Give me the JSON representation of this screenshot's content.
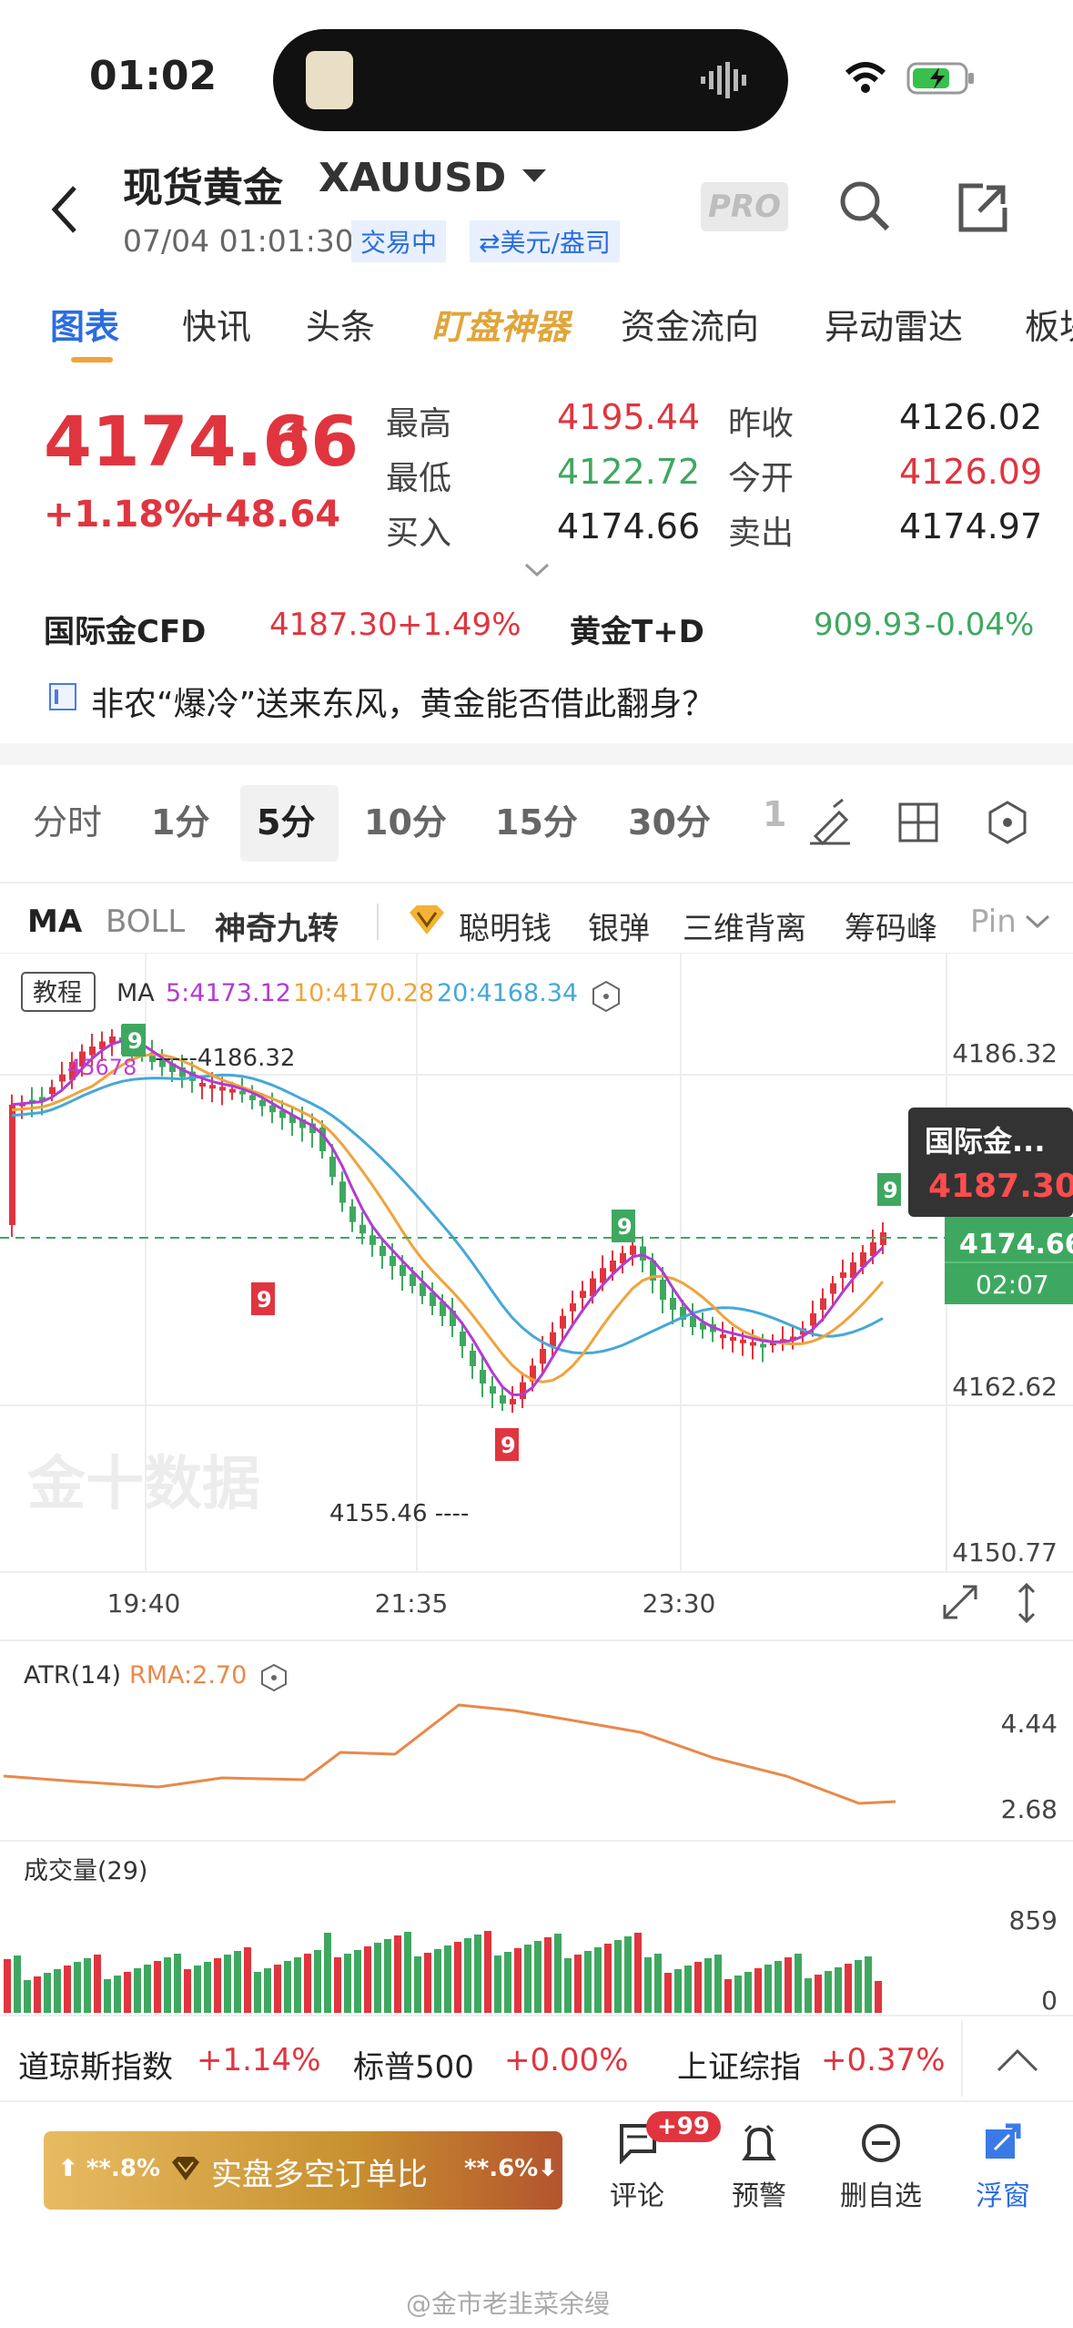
{
  "status_bar": {
    "time": "01:02"
  },
  "header": {
    "title": "现货黄金",
    "symbol": "XAUUSD",
    "datetime": "07/04 01:01:30",
    "trading_status": "交易中",
    "unit": "⇄美元/盎司",
    "pro_badge": "PRO"
  },
  "tabs": [
    {
      "label": "图表"
    },
    {
      "label": "快讯"
    },
    {
      "label": "头条"
    },
    {
      "label": "盯盘神器"
    },
    {
      "label": "资金流向"
    },
    {
      "label": "异动雷达"
    },
    {
      "label": "板块"
    }
  ],
  "quote": {
    "price": "4174.66",
    "arrow": "⬆",
    "change_pct": "+1.18%",
    "change": "+48.64",
    "stats": [
      {
        "label": "最高",
        "value": "4195.44",
        "color": "red"
      },
      {
        "label": "昨收",
        "value": "4126.02",
        "color": "dark"
      },
      {
        "label": "最低",
        "value": "4122.72",
        "color": "green"
      },
      {
        "label": "今开",
        "value": "4126.09",
        "color": "red"
      },
      {
        "label": "买入",
        "value": "4174.66",
        "color": "dark"
      },
      {
        "label": "卖出",
        "value": "4174.97",
        "color": "dark"
      }
    ]
  },
  "related": [
    {
      "name": "国际金CFD",
      "price": "4187.30",
      "change": "+1.49%",
      "dir": "up"
    },
    {
      "name": "黄金T+D",
      "price": "909.93",
      "change": "-0.04%",
      "dir": "down"
    }
  ],
  "news": {
    "headline": "非农“爆冷”送来东风，黄金能否借此翻身？"
  },
  "periods": [
    "分时",
    "1分",
    "5分",
    "10分",
    "15分",
    "30分",
    "1"
  ],
  "selected_period": "5分",
  "indicators": [
    "MA",
    "BOLL",
    "神奇九转",
    "聪明钱",
    "银弹",
    "三维背离",
    "筹码峰",
    "Pin"
  ],
  "chart": {
    "tutorial": "教程",
    "ma_title": "MA",
    "ma5": "5:4173.12",
    "ma10": "10:4170.28",
    "ma20": "20:4168.34",
    "y_ticks": [
      "4186.32",
      "4174.66",
      "4162.62",
      "4150.77"
    ],
    "high_label": "4186.32",
    "low_label": "4155.46",
    "x_ticks": [
      "19:40",
      "21:35",
      "23:30"
    ],
    "callout_name": "国际金...",
    "callout_price": "4187.30",
    "last_price": "4174.66",
    "countdown": "02:07",
    "watermark": "金十数据",
    "seq_top": "45678",
    "seq_nine": "9"
  },
  "atr": {
    "label": "ATR(14)",
    "rma": "RMA:2.70",
    "y_ticks": [
      "4.44",
      "2.68"
    ]
  },
  "volume": {
    "label": "成交量(29)",
    "y_ticks": [
      "859",
      "0"
    ]
  },
  "indices": [
    {
      "name": "道琼斯指数",
      "value": "+1.14%"
    },
    {
      "name": "标普500",
      "value": "+0.00%"
    },
    {
      "name": "上证综指",
      "value": "+0.37%"
    }
  ],
  "bottom": {
    "long_pct": "⬆ **.8%",
    "center": "实盘多空订单比",
    "short_pct": "**.6%⬇",
    "comment_badge": "+99",
    "nav": [
      {
        "label": "评论"
      },
      {
        "label": "预警"
      },
      {
        "label": "删自选"
      },
      {
        "label": "浮窗"
      }
    ]
  },
  "footer": {
    "watermark": "@金市老韭菜余缦"
  },
  "colors": {
    "up": "#e0353f",
    "down": "#3fa860",
    "accent": "#2a6de0",
    "ma5": "#b23bd4",
    "ma10": "#f0a33a",
    "ma20": "#45a8d8",
    "atr": "#e8894a"
  }
}
